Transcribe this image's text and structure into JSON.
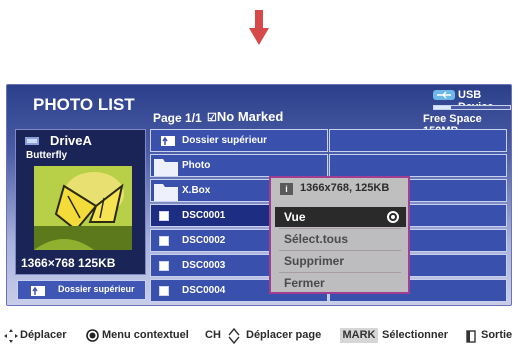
{
  "header": {
    "title": "PHOTO LIST",
    "page_info": "Page 1/1",
    "no_marked": "No Marked",
    "device": "USB Device",
    "free_space": "Free Space 150MB",
    "storage_used_fraction": 0.22
  },
  "preview": {
    "drive": "DriveA",
    "file_name": "Butterfly",
    "resolution_size": "1366×768  125KB",
    "parent_button": "Dossier supérieur"
  },
  "file_list": {
    "items": [
      {
        "label": "Dossier supérieur",
        "type": "parent-folder",
        "selected": false
      },
      {
        "label": "Photo",
        "type": "folder",
        "selected": false
      },
      {
        "label": "X.Box",
        "type": "folder",
        "selected": false
      },
      {
        "label": "DSC0001",
        "type": "photo",
        "selected": true
      },
      {
        "label": "DSC0002",
        "type": "photo",
        "selected": false
      },
      {
        "label": "DSC0003",
        "type": "photo",
        "selected": false
      },
      {
        "label": "DSC0004",
        "type": "photo",
        "selected": false
      }
    ]
  },
  "context_menu": {
    "header": "1366x768, 125KB",
    "info_icon": "i",
    "items": [
      {
        "label": "Vue",
        "active": true
      },
      {
        "label": "Sélect.tous",
        "active": false
      },
      {
        "label": "Supprimer",
        "active": false
      },
      {
        "label": "Fermer",
        "active": false
      }
    ]
  },
  "footer": {
    "move": "Déplacer",
    "context_menu": "Menu contextuel",
    "ch": "CH",
    "move_page": "Déplacer page",
    "mark": "MARK",
    "select": "Sélectionner",
    "exit": "Sortie"
  },
  "colors": {
    "accent_arrow": "#d64a4a",
    "menu_border": "#a13e92",
    "row_blue": "#3a50ad",
    "row_selected": "#1c2d82"
  }
}
